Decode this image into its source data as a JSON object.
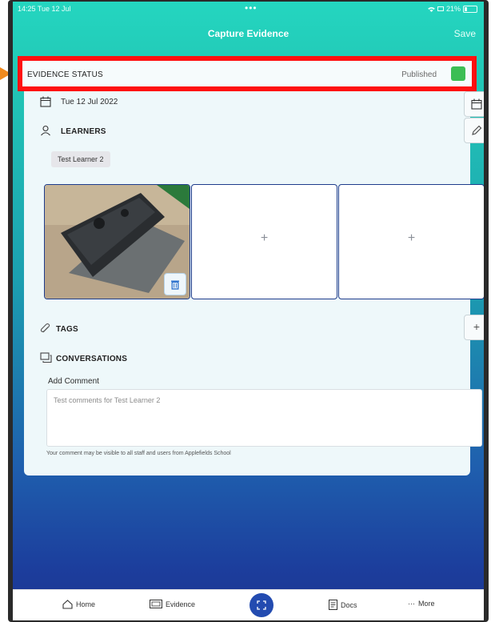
{
  "status_bar": {
    "time": "14:25  Tue 12 Jul",
    "dots": "•••",
    "battery_text": "21%"
  },
  "nav": {
    "title": "Capture Evidence",
    "save_label": "Save"
  },
  "evidence_status": {
    "label": "EVIDENCE STATUS",
    "value": "Published",
    "color": "#3cbe54"
  },
  "date": {
    "value": "Tue 12 Jul 2022"
  },
  "learners": {
    "heading": "LEARNERS",
    "chips": [
      "Test Learner 2"
    ]
  },
  "media": {
    "add_symbol": "+"
  },
  "tags": {
    "heading": "TAGS",
    "add_symbol": "+"
  },
  "conversations": {
    "heading": "CONVERSATIONS",
    "add_comment_label": "Add Comment",
    "comment_placeholder": "Test comments for Test Learner 2",
    "visibility_note": "Your comment may be visible to all staff and users from Applefields School"
  },
  "bottom_nav": {
    "home": "Home",
    "evidence": "Evidence",
    "docs": "Docs",
    "more": "More",
    "more_dots": "···"
  },
  "colors": {
    "accent_primary": "#234bb0",
    "highlight_border": "#ff1010",
    "pointer": "#f08a1e"
  }
}
